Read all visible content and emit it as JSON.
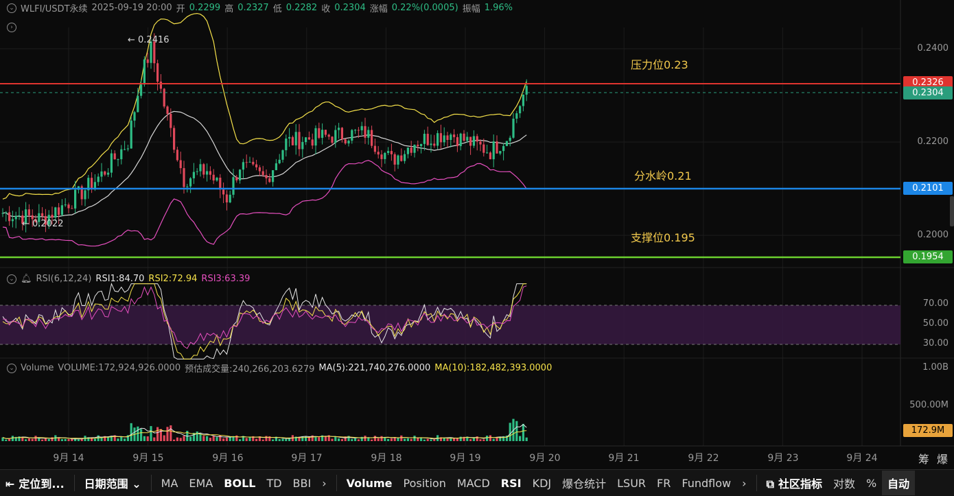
{
  "header": {
    "symbol": "WLFI/USDT永续",
    "datetime": "2025-09-19 20:00",
    "open_label": "开",
    "open": "0.2299",
    "high_label": "高",
    "high": "0.2327",
    "low_label": "低",
    "low": "0.2282",
    "close_label": "收",
    "close": "0.2304",
    "change_label": "涨幅",
    "change": "0.22%(0.0005)",
    "amp_label": "振幅",
    "amp": "1.96%"
  },
  "price_axis": [
    "0.2400",
    "0.2200",
    "0.2000"
  ],
  "price_tags": {
    "resistance_line": "0.2326",
    "last": "0.2304",
    "pivot_line": "0.2101",
    "support_line": "0.1954"
  },
  "annotations": {
    "resistance": "压力位0.23",
    "pivot": "分水岭0.21",
    "support": "支撑位0.195"
  },
  "extremes": {
    "high": "← 0.2416",
    "low": "← 0.2022"
  },
  "rsi": {
    "name": "RSI(6,12,24)",
    "rsi1": "RSI1:84.70",
    "rsi2": "RSI2:72.94",
    "rsi3": "RSI3:63.39",
    "axis": [
      "70.00",
      "50.00",
      "30.00"
    ]
  },
  "volume": {
    "name": "Volume",
    "value": "VOLUME:172,924,926.0000",
    "estimate": "预估成交量:240,266,203.6279",
    "ma5": "MA(5):221,740,276.0000",
    "ma10": "MA(10):182,482,393.0000",
    "axis": [
      "1.00B",
      "500.00M"
    ],
    "tag": "172.9M"
  },
  "x_axis": [
    "9月 14",
    "9月 15",
    "9月 16",
    "9月 17",
    "9月 18",
    "9月 19",
    "9月 20",
    "9月 21",
    "9月 22",
    "9月 23",
    "9月 24"
  ],
  "corner": {
    "a": "筹",
    "b": "爆"
  },
  "toolbar": {
    "locate": "定位到...",
    "range": "日期范围",
    "main_indicators": [
      "MA",
      "EMA",
      "BOLL",
      "TD",
      "BBI"
    ],
    "sub_indicators": [
      "Volume",
      "Position",
      "MACD",
      "RSI",
      "KDJ",
      "爆仓统计",
      "LSUR",
      "FR",
      "Fundflow"
    ],
    "community": "社区指标",
    "log": "对数",
    "percent": "%",
    "auto": "自动"
  },
  "colors": {
    "up": "#2ebd85",
    "down": "#e0485a",
    "boll_upper": "#f5e14a",
    "boll_mid": "#d8d8d8",
    "boll_lower": "#e64fbf",
    "resistance": "#e0342f",
    "pivot": "#1c86e6",
    "support": "#6cd12e"
  }
}
